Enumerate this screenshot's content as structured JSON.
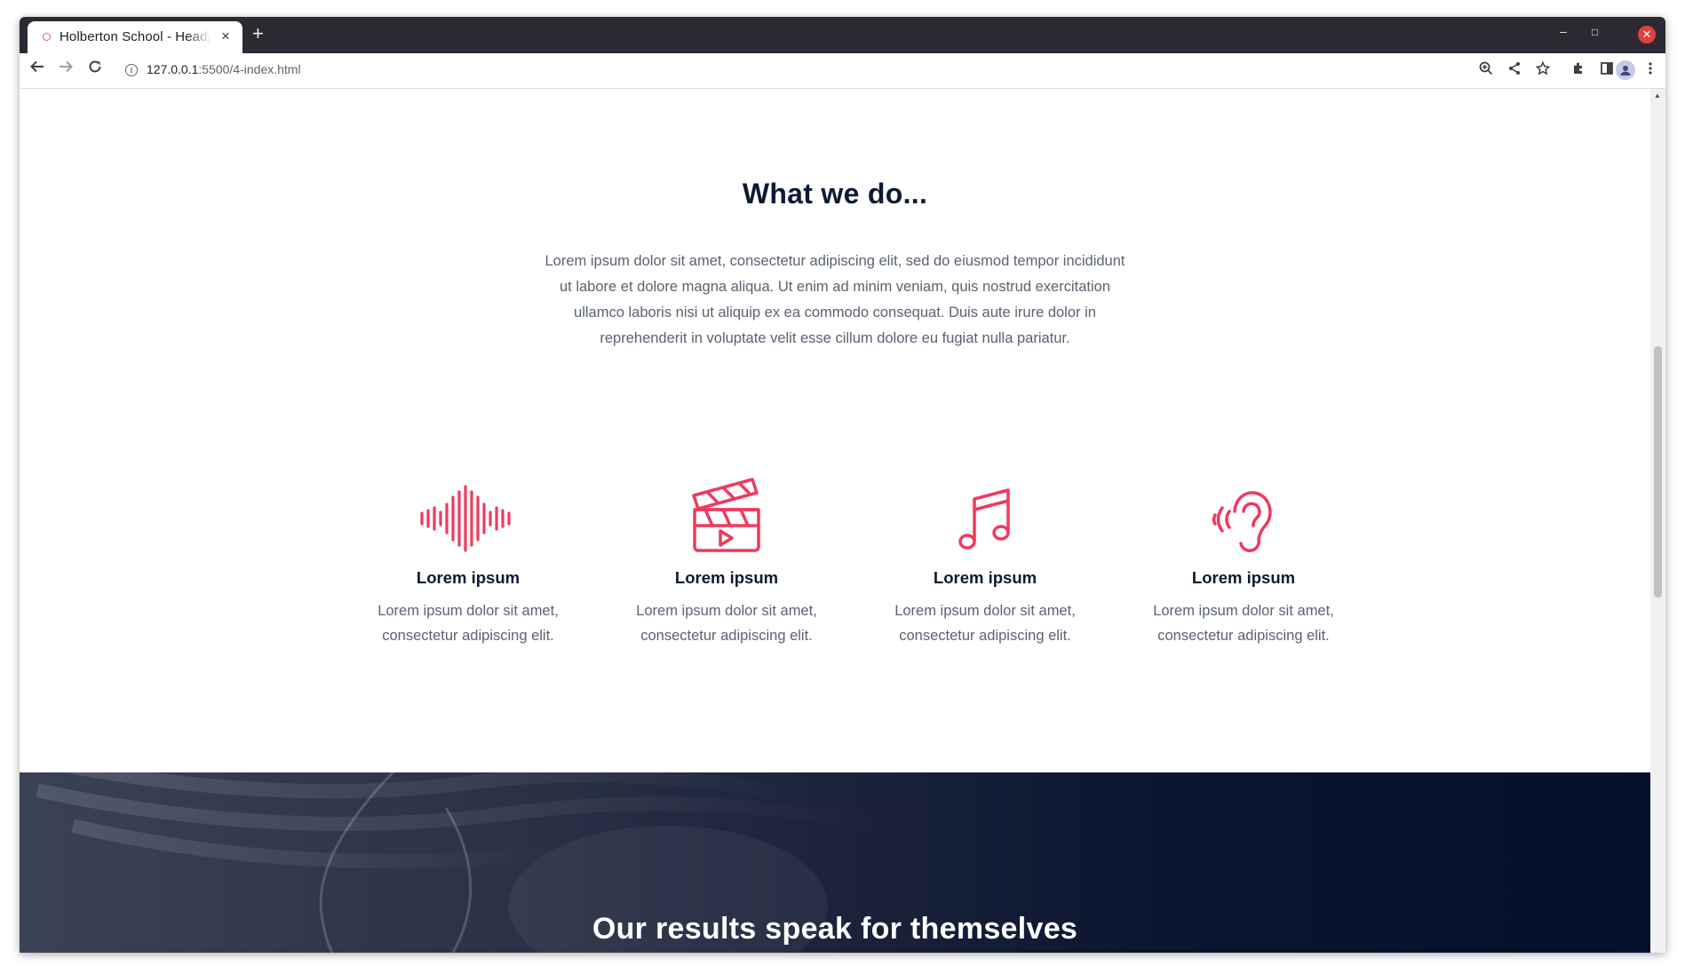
{
  "browser": {
    "tab_title": "Holberton School - Headphones",
    "tab_close": "×",
    "new_tab": "+",
    "url_host": "127.0.0.1",
    "url_path": ":5500/4-index.html",
    "window_controls": {
      "minimize": "–",
      "maximize": "□",
      "close": "✕"
    }
  },
  "section": {
    "title": "What we do...",
    "intro": "Lorem ipsum dolor sit amet, consectetur adipiscing elit, sed do eiusmod tempor incididunt ut labore et dolore magna aliqua. Ut enim ad minim veniam, quis nostrud exercitation ullamco laboris nisi ut aliquip ex ea commodo consequat. Duis aute irure dolor in reprehenderit in voluptate velit esse cillum dolore eu fugiat nulla pariatur."
  },
  "features": [
    {
      "icon": "sound-wave-icon",
      "title": "Lorem ipsum",
      "text": "Lorem ipsum dolor sit amet, consectetur adipiscing elit."
    },
    {
      "icon": "clapperboard-icon",
      "title": "Lorem ipsum",
      "text": "Lorem ipsum dolor sit amet, consectetur adipiscing elit."
    },
    {
      "icon": "music-note-icon",
      "title": "Lorem ipsum",
      "text": "Lorem ipsum dolor sit amet, consectetur adipiscing elit."
    },
    {
      "icon": "ear-icon",
      "title": "Lorem ipsum",
      "text": "Lorem ipsum dolor sit amet, consectetur adipiscing elit."
    }
  ],
  "results": {
    "title": "Our results speak for themselves"
  },
  "colors": {
    "accent": "#f0395f",
    "heading": "#0c1a34",
    "body_text": "#5a6272",
    "dark_bg": "#03102b"
  }
}
